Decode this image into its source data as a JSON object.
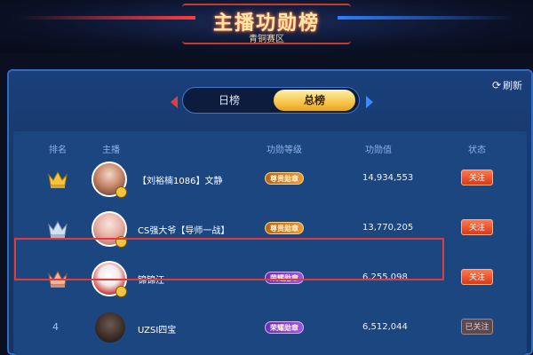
{
  "header": {
    "title": "主播功勋榜",
    "subtitle": "青铜赛区"
  },
  "panel": {
    "refresh_label": "刷新"
  },
  "tabs": [
    {
      "label": "日榜",
      "active": false
    },
    {
      "label": "总榜",
      "active": true
    }
  ],
  "columns": {
    "rank": "排名",
    "anchor": "主播",
    "level": "功勋等级",
    "value": "功勋值",
    "follow": "状态"
  },
  "rows": [
    {
      "rank": "1",
      "crown": "gold-crown-icon",
      "name": "【刘裕楠1086】文静",
      "level": "尊贵勋章",
      "level_color": "gold",
      "value": "14,934,553",
      "follow": "关注",
      "followed": false
    },
    {
      "rank": "2",
      "crown": "silver-crown-icon",
      "name": "CS强大爷【导师一战】",
      "level": "尊贵勋章",
      "level_color": "gold",
      "value": "13,770,205",
      "follow": "关注",
      "followed": false
    },
    {
      "rank": "3",
      "crown": "bronze-crown-icon",
      "name": "锦锦汪",
      "level": "荣耀勋章",
      "level_color": "purple",
      "value": "6,255,098",
      "follow": "关注",
      "followed": false
    },
    {
      "rank": "4",
      "crown": "",
      "name": "UZSI四宝",
      "level": "荣耀勋章",
      "level_color": "purple",
      "value": "6,512,044",
      "follow": "已关注",
      "followed": true
    }
  ],
  "colors": {
    "accent_red": "#e23b3b",
    "accent_blue": "#2f7dff",
    "gold": "#f6c54a",
    "panel_bg": "#1b4680"
  }
}
